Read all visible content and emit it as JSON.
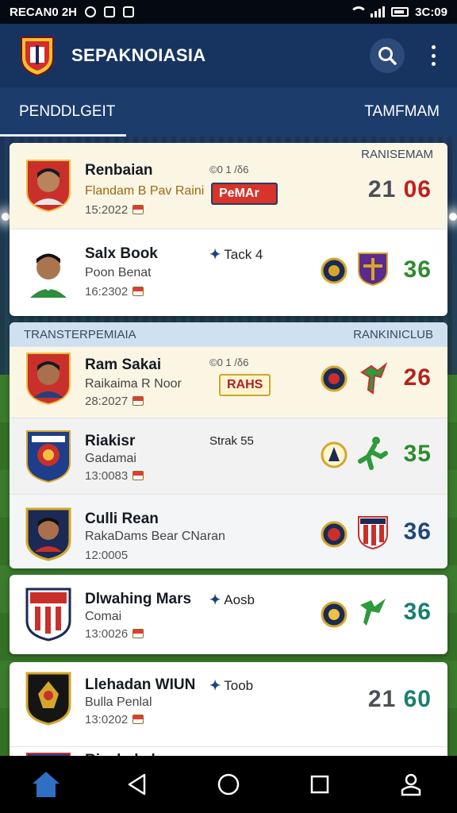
{
  "status_bar": {
    "carrier": "RECAN0 2H",
    "time": "3C:09"
  },
  "app": {
    "title": "SEPAKNOIASIA"
  },
  "tabs": [
    {
      "label": "PENDDLGEIT",
      "active": true
    },
    {
      "label": "TAMFMAM",
      "active": false
    }
  ],
  "card1": {
    "header_right": "RANISEMAM",
    "rows": [
      {
        "name": "Renbaian",
        "sub": "Flandam B Pav Raini",
        "date": "15:2022",
        "meta": "©0 1 /δ6",
        "badge": "PeMAr",
        "score_a": "21",
        "score_b": "06"
      },
      {
        "name": "Salx Book",
        "sub": "Poon Benat",
        "date": "16:2302",
        "meta": "Tack 4",
        "score": "36"
      }
    ]
  },
  "card2": {
    "header_left": "TRANSTERPEMIAIA",
    "header_right": "RANKINICLUB",
    "rows": [
      {
        "name": "Ram Sakai",
        "sub": "Raikaima R Noor",
        "date": "28:2027",
        "meta": "©0 1 /δ6",
        "badge": "RAHS",
        "score": "26"
      },
      {
        "name": "Riakisr",
        "sub": "Gadamai",
        "date": "13:0083",
        "meta": "Strak 55",
        "score": "35"
      },
      {
        "name": "Culli Rean",
        "sub": "RakaDams Bear CNaran",
        "date": "12:0005",
        "score": "36"
      }
    ]
  },
  "card3": {
    "rows": [
      {
        "name": "Dlwahing Mars",
        "sub": "Comai",
        "date": "13:0026",
        "meta": "Aosb",
        "score": "36"
      }
    ]
  },
  "card4": {
    "rows": [
      {
        "name": "Llehadan WIUN",
        "sub": "Bulla Penlal",
        "date": "13:0202",
        "meta": "Toob",
        "score_a": "21",
        "score_b": "60"
      },
      {
        "name": "Riaebakels"
      }
    ]
  },
  "colors": {
    "appbar": "#173461",
    "tabs": "#1c3c6c",
    "accent_red": "#c0201d",
    "green": "#2e8b2e"
  },
  "icons": [
    "search-icon",
    "more-vert-icon",
    "home-icon",
    "back-icon",
    "circle-home-icon",
    "recents-icon",
    "profile-icon"
  ]
}
